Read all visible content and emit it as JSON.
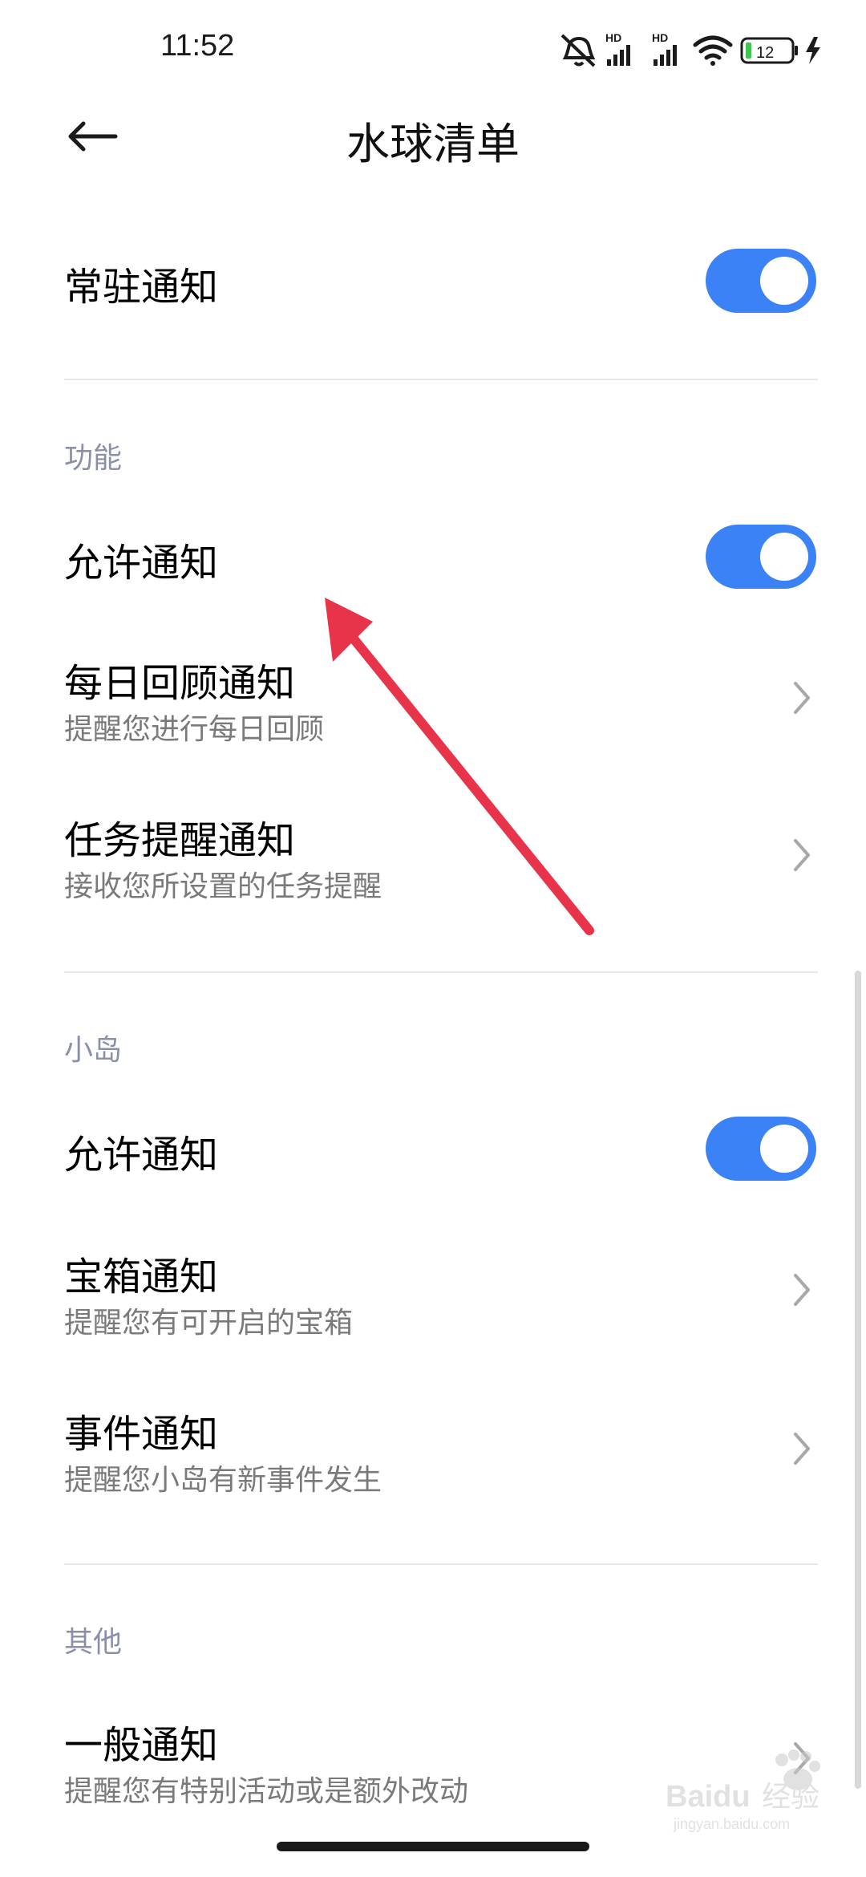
{
  "status_bar": {
    "time": "11:52",
    "network_label_1": "HD",
    "network_label_2": "HD",
    "battery": "12"
  },
  "header": {
    "title": "水球清单"
  },
  "persistent": {
    "title": "常驻通知",
    "toggle_on": true
  },
  "sections": {
    "features": {
      "label": "功能",
      "allow": {
        "title": "允许通知",
        "toggle_on": true
      },
      "daily": {
        "title": "每日回顾通知",
        "subtitle": "提醒您进行每日回顾"
      },
      "task": {
        "title": "任务提醒通知",
        "subtitle": "接收您所设置的任务提醒"
      }
    },
    "island": {
      "label": "小岛",
      "allow": {
        "title": "允许通知",
        "toggle_on": true
      },
      "chest": {
        "title": "宝箱通知",
        "subtitle": "提醒您有可开启的宝箱"
      },
      "event": {
        "title": "事件通知",
        "subtitle": "提醒您小岛有新事件发生"
      }
    },
    "other": {
      "label": "其他",
      "general": {
        "title": "一般通知",
        "subtitle": "提醒您有特别活动或是额外改动"
      }
    }
  },
  "colors": {
    "toggle_on": "#3a82f6",
    "annotation_arrow": "#e8344a",
    "section_label": "#8a90a8"
  },
  "icons": {
    "back": "arrow-left-icon",
    "chevron": "chevron-right-icon",
    "mute": "bell-off-icon",
    "signal": "signal-bars-icon",
    "wifi": "wifi-icon",
    "battery": "battery-icon",
    "charging": "bolt-icon"
  },
  "watermark": {
    "brand": "Baidu",
    "brand_cn": "经验",
    "domain": "jingyan.baidu.com"
  }
}
